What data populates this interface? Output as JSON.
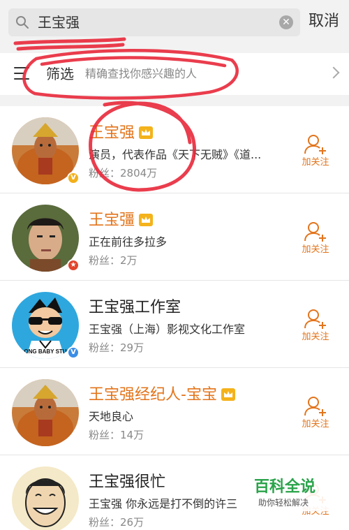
{
  "search": {
    "query": "王宝强",
    "cancel_label": "取消"
  },
  "filter": {
    "label": "筛选",
    "hint": "精确查找你感兴趣的人"
  },
  "results": [
    {
      "name": "王宝强",
      "description": "演员，代表作品《天下无贼》《道...",
      "fans": "粉丝：2804万",
      "follow_label": "加关注"
    },
    {
      "name": "王宝彊",
      "description": "正在前往多拉多",
      "fans": "粉丝：2万",
      "follow_label": "加关注"
    },
    {
      "name": "王宝强工作室",
      "description": "王宝强（上海）影视文化工作室",
      "fans": "粉丝：29万",
      "follow_label": "加关注",
      "avatar_text": "ONG BABY STU"
    },
    {
      "name": "王宝强经纪人-宝宝",
      "description": "天地良心",
      "fans": "粉丝：14万",
      "follow_label": "加关注"
    },
    {
      "name": "王宝强很忙",
      "description": "王宝强 你永远是打不倒的许三",
      "fans": "粉丝：26万",
      "follow_label": "加关注"
    }
  ],
  "watermark": {
    "title": "百科全说",
    "subtitle": "助你轻松解决"
  },
  "colors": {
    "accent": "#e3741b",
    "annotation": "#e8283a",
    "watermark": "#2aa34a"
  }
}
